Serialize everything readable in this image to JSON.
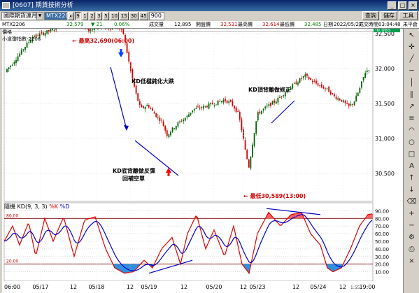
{
  "window": {
    "title": "[0607] 期貨技術分析"
  },
  "toolbar": {
    "contract_selector": "國際期貨連月",
    "symbol_selector": "MTX2206",
    "buttons": [
      "1",
      "2",
      "3",
      "5",
      "10",
      "15",
      "30",
      "45"
    ],
    "active_button": "9",
    "interval_value": "900",
    "right_buttons": [
      "查詢",
      "儲存",
      "工具"
    ]
  },
  "quote": {
    "symbol": "MTX2206",
    "price": "32,579",
    "change": "▼ 21",
    "change_pct": "0.06%",
    "volume_label": "成交量",
    "volume": "12,895",
    "open_label": "開盤價",
    "open": "32,531",
    "high_label": "最高價",
    "high": "32,614",
    "low_label": "最低價",
    "low": "32,485",
    "date_label": "日期",
    "date": "2022/05/27",
    "time_label": "成交時間",
    "time": "03:04:48",
    "status": "未平倉"
  },
  "main_panel": {
    "panel_label": "價格",
    "series_label": "小道瓊指數-2206",
    "current_price": "32,579",
    "current_change": "-0.065",
    "y_ticks": [
      "32,500",
      "32,000",
      "31,500",
      "31,000",
      "30,500"
    ],
    "annotations": {
      "high": "← 最高32,690(06:00)",
      "kd_blunt": "KD低檔鈍化大跌",
      "kd_bull_div_line1": "KD底背離做反彈",
      "kd_bull_div_line2": "回補空單",
      "kd_bear_div": "KD頂背離做修正",
      "low": "← 最低30,589(13:00)"
    }
  },
  "kd_panel": {
    "title": "隨機 KD(9, 3, 3)",
    "k_label": "%K",
    "d_label": "%D",
    "y_ticks": [
      "90.00",
      "80.00",
      "70.00",
      "60.00",
      "50.00",
      "40.00",
      "30.00",
      "20.00",
      "10.00"
    ],
    "upper_level_label": "80.00",
    "lower_level_label": "20.00"
  },
  "x_axis": {
    "labels": [
      "06:00",
      "05/17",
      "12",
      "05/18",
      "12",
      "05/19",
      "12",
      "05/20",
      "12",
      "05/23",
      "12",
      "05/24",
      "12",
      "19:00"
    ],
    "scroll_value": "1:55"
  },
  "colors": {
    "up_candle": "#006400",
    "down_candle": "#cc0000",
    "k_line": "#e00000",
    "d_line": "#0000cc",
    "annotation_red": "#cc0000",
    "annotation_dark": "#000000",
    "trend_line": "#0000cc",
    "price_badge": "#00a050"
  },
  "icons": {
    "window": "window-icon",
    "minimize": "minimize-icon",
    "restore": "restore-icon",
    "close": "close-icon"
  }
}
